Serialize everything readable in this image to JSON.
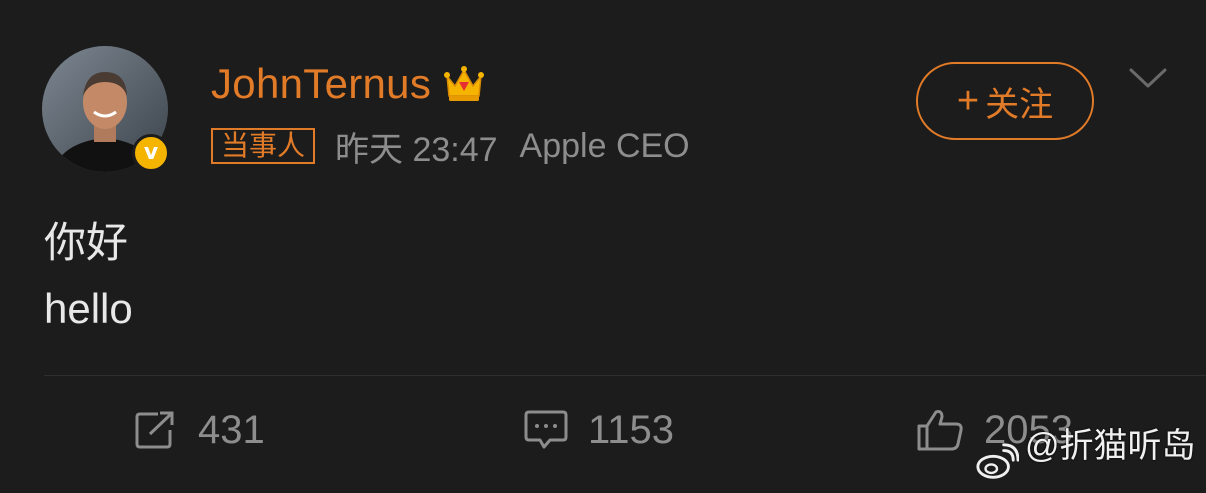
{
  "post": {
    "author": {
      "name": "JohnTernus",
      "tag": "当事人",
      "time": "昨天 23:47",
      "title": "Apple CEO",
      "verified_mark": "v"
    },
    "follow_label": "关注",
    "follow_plus": "+",
    "content": {
      "line1": "你好",
      "line2": "hello"
    },
    "actions": {
      "reposts": "431",
      "comments": "1153",
      "likes": "2053"
    }
  },
  "watermark": {
    "text": "@折猫听岛_"
  },
  "colors": {
    "accent": "#e27b28",
    "background": "#1c1c1c",
    "muted": "#8d8d8d",
    "text": "#e8e8e8",
    "badge": "#f5b400"
  },
  "icons": [
    "avatar-photo",
    "verified-icon",
    "crown-icon",
    "chevron-down-icon",
    "repost-icon",
    "comment-icon",
    "like-icon",
    "weibo-logo-icon"
  ]
}
